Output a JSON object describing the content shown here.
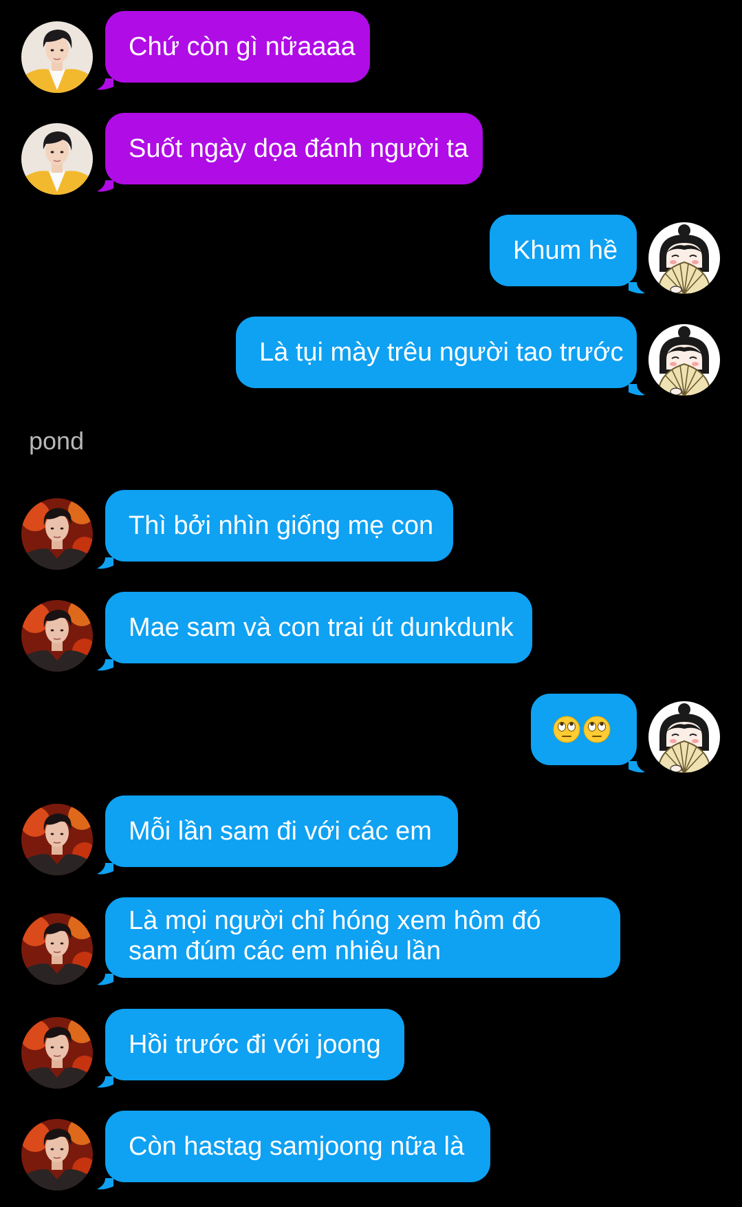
{
  "colors": {
    "background": "#000000",
    "partner1_bubble": "#b00ce6",
    "partner2_bubble": "#0fa1f2",
    "me_bubble": "#0fa1f2",
    "sender_name": "#b8b8b8"
  },
  "conversation": {
    "sender_label_pond": "pond",
    "messages": [
      {
        "from": "partner-yellow-jacket",
        "text": "Chứ còn gì nữaaaa"
      },
      {
        "from": "partner-yellow-jacket",
        "text": "Suốt ngày dọa đánh người ta"
      },
      {
        "from": "me",
        "text": "Khum hề"
      },
      {
        "from": "me",
        "text": "Là tụi mày trêu người tao trước"
      },
      {
        "from": "pond",
        "text": "Thì bởi nhìn giống mẹ con"
      },
      {
        "from": "pond",
        "text": "Mae sam và con trai út dunkdunk"
      },
      {
        "from": "me",
        "text": "",
        "emoji": [
          "face-with-rolling-eyes",
          "face-with-rolling-eyes"
        ]
      },
      {
        "from": "pond",
        "text": "Mỗi lần sam đi với các em"
      },
      {
        "from": "pond",
        "text": "Là mọi người chỉ hóng xem hôm đó sam đúm các em nhiêu lần"
      },
      {
        "from": "pond",
        "text": "Hồi trước đi với joong"
      },
      {
        "from": "pond",
        "text": "Còn hastag samjoong nữa là"
      }
    ]
  },
  "avatars": {
    "partner_yellow": "avatar-person-yellow-jacket",
    "me": "avatar-anime-girl-fan",
    "pond": "avatar-person-red-stage"
  }
}
